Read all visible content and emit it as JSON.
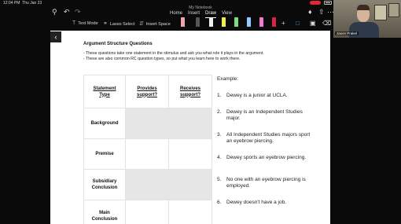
{
  "status_bar": {
    "time": "12:04 PM",
    "date": "Thu Jan 23"
  },
  "toolbar": {
    "document_title": "My Notebook",
    "menus": [
      "Home",
      "Insert",
      "Draw",
      "View"
    ],
    "active_menu": "Draw"
  },
  "tools": {
    "text_mode": "Text Mode",
    "lasso_select": "Lasso Select",
    "insert_space": "Insert Space",
    "pen_colors": [
      "#f4a3b0",
      "#444444",
      "#f0f0f0",
      "#f2ec55",
      "#7be07b",
      "#8ecbff",
      "#f07acb",
      "#e8e8e8",
      "#d7263d",
      "#222222",
      "#e84fd0"
    ]
  },
  "video": {
    "participant_name": "Jason Prakel"
  },
  "sheet": {
    "title": "Argument Structure Questions",
    "bullets": [
      "- These questions take one statement in the stimulus and ask you what role it plays in the argument.",
      "- These are also common RC question types, so put what you learn here to work there."
    ],
    "table": {
      "headers": [
        [
          "Statement",
          "Type"
        ],
        [
          "Provides",
          "support?"
        ],
        [
          "Receives",
          "support?"
        ]
      ],
      "rows": [
        [
          "Background"
        ],
        [
          "Premise"
        ],
        [
          "Subsidiary",
          "Conclusion"
        ],
        [
          "Main",
          "Conclusion"
        ]
      ]
    },
    "example_title": "Example:",
    "examples": [
      {
        "num": "1.",
        "text": "Dewey is a junior at UCLA."
      },
      {
        "num": "2.",
        "text": "Dewey is an Independent Studies major."
      },
      {
        "num": "3.",
        "text": "All Independent Studies majors sport an eyebrow piercing."
      },
      {
        "num": "4.",
        "text": "Dewey sports an eyebrow piercing."
      },
      {
        "num": "5.",
        "text": "No one with an eyebrow piercing is employed."
      },
      {
        "num": "6.",
        "text": "Dewey doesn't have a job."
      }
    ]
  }
}
